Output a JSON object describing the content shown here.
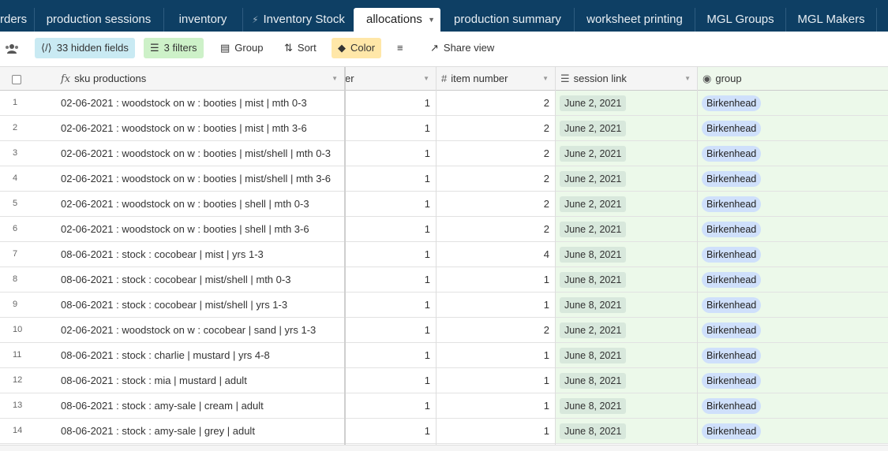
{
  "tabs": [
    {
      "label": "rders"
    },
    {
      "label": "production sessions"
    },
    {
      "label": "inventory"
    },
    {
      "label": "Inventory Stock"
    },
    {
      "label": "allocations"
    },
    {
      "label": "production summary"
    },
    {
      "label": "worksheet printing"
    },
    {
      "label": "MGL Groups"
    },
    {
      "label": "MGL Makers"
    }
  ],
  "toolbar": {
    "hidden_fields": "33 hidden fields",
    "filters": "3 filters",
    "group": "Group",
    "sort": "Sort",
    "color": "Color",
    "share_view": "Share view"
  },
  "columns": {
    "sku": "sku productions",
    "col_partial": "er",
    "item_number": "item number",
    "session_link": "session link",
    "group": "group"
  },
  "rows": [
    {
      "n": "1",
      "sku": "02-06-2021 : woodstock on w : booties | mist | mth 0-3",
      "a": "1",
      "item": "2",
      "session": "June 2, 2021",
      "group": "Birkenhead"
    },
    {
      "n": "2",
      "sku": "02-06-2021 : woodstock on w : booties | mist | mth 3-6",
      "a": "1",
      "item": "2",
      "session": "June 2, 2021",
      "group": "Birkenhead"
    },
    {
      "n": "3",
      "sku": "02-06-2021 : woodstock on w : booties | mist/shell | mth 0-3",
      "a": "1",
      "item": "2",
      "session": "June 2, 2021",
      "group": "Birkenhead"
    },
    {
      "n": "4",
      "sku": "02-06-2021 : woodstock on w : booties | mist/shell | mth 3-6",
      "a": "1",
      "item": "2",
      "session": "June 2, 2021",
      "group": "Birkenhead"
    },
    {
      "n": "5",
      "sku": "02-06-2021 : woodstock on w : booties | shell | mth 0-3",
      "a": "1",
      "item": "2",
      "session": "June 2, 2021",
      "group": "Birkenhead"
    },
    {
      "n": "6",
      "sku": "02-06-2021 : woodstock on w : booties | shell | mth 3-6",
      "a": "1",
      "item": "2",
      "session": "June 2, 2021",
      "group": "Birkenhead"
    },
    {
      "n": "7",
      "sku": "08-06-2021 : stock : cocobear | mist | yrs 1-3",
      "a": "1",
      "item": "4",
      "session": "June 8, 2021",
      "group": "Birkenhead"
    },
    {
      "n": "8",
      "sku": "08-06-2021 : stock : cocobear | mist/shell | mth 0-3",
      "a": "1",
      "item": "1",
      "session": "June 8, 2021",
      "group": "Birkenhead"
    },
    {
      "n": "9",
      "sku": "08-06-2021 : stock : cocobear | mist/shell | yrs 1-3",
      "a": "1",
      "item": "1",
      "session": "June 8, 2021",
      "group": "Birkenhead"
    },
    {
      "n": "10",
      "sku": "02-06-2021 : woodstock on w : cocobear | sand | yrs 1-3",
      "a": "1",
      "item": "2",
      "session": "June 2, 2021",
      "group": "Birkenhead"
    },
    {
      "n": "11",
      "sku": "08-06-2021 : stock : charlie | mustard | yrs 4-8",
      "a": "1",
      "item": "1",
      "session": "June 8, 2021",
      "group": "Birkenhead"
    },
    {
      "n": "12",
      "sku": "08-06-2021 : stock : mia | mustard | adult",
      "a": "1",
      "item": "1",
      "session": "June 8, 2021",
      "group": "Birkenhead"
    },
    {
      "n": "13",
      "sku": "08-06-2021 : stock : amy-sale | cream | adult",
      "a": "1",
      "item": "1",
      "session": "June 8, 2021",
      "group": "Birkenhead"
    },
    {
      "n": "14",
      "sku": "08-06-2021 : stock : amy-sale | grey | adult",
      "a": "1",
      "item": "1",
      "session": "June 8, 2021",
      "group": "Birkenhead"
    }
  ]
}
